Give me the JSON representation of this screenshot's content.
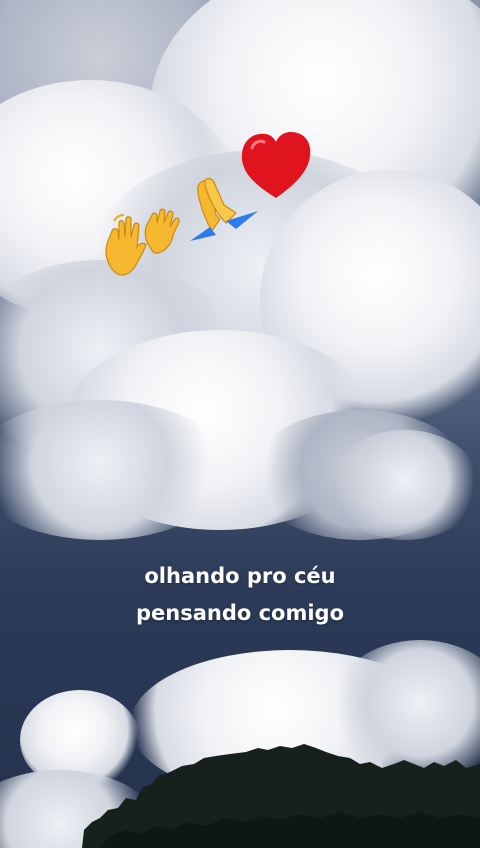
{
  "caption": {
    "line1": "olhando pro céu",
    "line2": "pensando comigo"
  },
  "stickers": [
    "waving-hands-icon",
    "folded-hands-icon",
    "red-heart-icon"
  ],
  "colors": {
    "sky_dark": "#24324d",
    "cloud": "#f2f3f6",
    "heart": "#e0141f",
    "hands": "#f5b82e",
    "sleeve": "#2f7bea",
    "tree": "#16201c"
  }
}
